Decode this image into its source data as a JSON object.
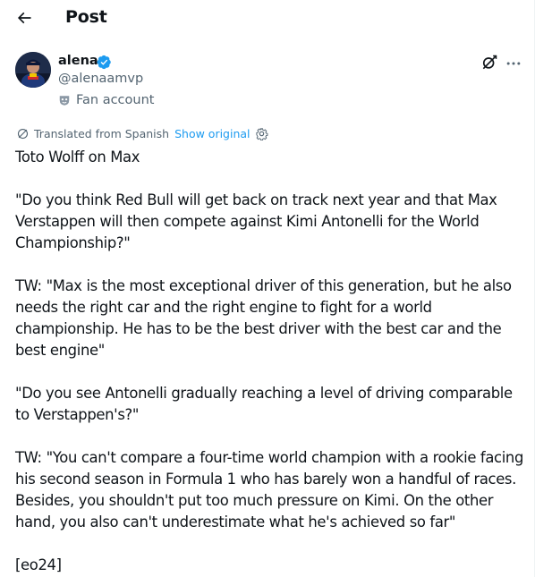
{
  "header": {
    "title": "Post"
  },
  "author": {
    "name": "alena",
    "handle": "@alenaamvp",
    "label": "Fan account"
  },
  "translation": {
    "note": "Translated from Spanish",
    "show_original": "Show original"
  },
  "post": {
    "text": "Toto Wolff on Max\n\n\"Do you think Red Bull will get back on track next year and that Max Verstappen will then compete against Kimi Antonelli for the World Championship?\"\n\nTW: \"Max is the most exceptional driver of this generation, but he also needs the right car and the right engine to fight for a world championship. He has to be the best driver with the best car and the best engine\"\n\n\"Do you see Antonelli gradually reaching a level of driving comparable to Verstappen's?\"\n\nTW: \"You can't compare a four-time world champion with a rookie facing his second season in Formula 1 who has barely won a handful of races. Besides, you shouldn't put too much pressure on Kimi. On the other hand, you also can't underestimate what he's achieved so far\"\n\n[eo24]"
  },
  "colors": {
    "accent": "#1d9bf0",
    "secondary_text": "#536471",
    "text": "#0f1419"
  },
  "icons": [
    "back-arrow-icon",
    "verified-badge-icon",
    "mask-icon",
    "grok-icon",
    "more-icon",
    "translate-icon",
    "settings-icon"
  ]
}
